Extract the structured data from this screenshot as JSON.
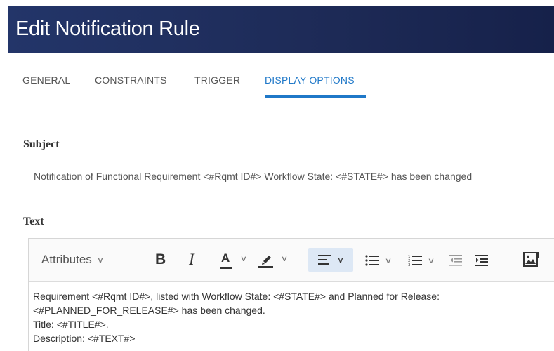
{
  "header": {
    "title": "Edit Notification Rule"
  },
  "tabs": [
    {
      "label": "GENERAL"
    },
    {
      "label": "CONSTRAINTS"
    },
    {
      "label": "TRIGGER"
    },
    {
      "label": "DISPLAY OPTIONS",
      "active": true
    }
  ],
  "subject": {
    "label": "Subject",
    "value": "Notification of Functional Requirement <#Rqmt ID#> Workflow State: <#STATE#> has been changed"
  },
  "text": {
    "label": "Text",
    "toolbar": {
      "attributes_label": "Attributes",
      "bold_label": "B",
      "italic_label": "I",
      "font_color_label": "A",
      "icons": [
        "chevron-down-icon",
        "font-color-icon",
        "highlight-icon",
        "align-left-icon",
        "bulleted-list-icon",
        "numbered-list-icon",
        "outdent-icon",
        "indent-icon",
        "image-icon"
      ]
    },
    "body_lines": [
      "Requirement <#Rqmt ID#>, listed with Workflow State: <#STATE#> and Planned for Release:",
      "<#PLANNED_FOR_RELEASE#> has been changed.",
      "Title: <#TITLE#>.",
      "Description: <#TEXT#>"
    ]
  },
  "colors": {
    "header_bg": "#1d2a56",
    "accent": "#1f78c8",
    "active_toolbar_bg": "#dde8f5"
  }
}
